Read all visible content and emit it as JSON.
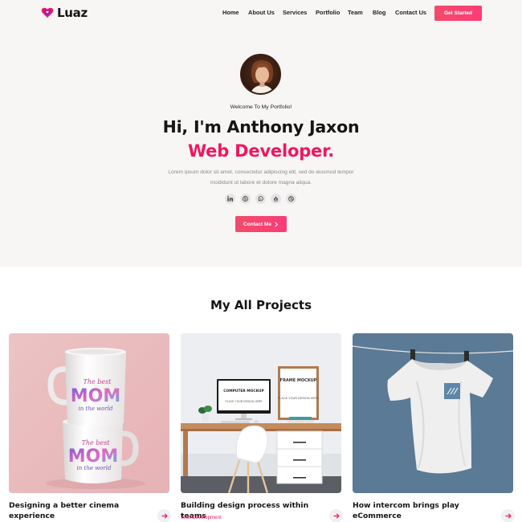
{
  "header": {
    "logo_text": "Luaz",
    "nav": [
      "Home",
      "About Us",
      "Services",
      "Portfolio",
      "Team",
      "Blog",
      "Contact Us"
    ],
    "cta_label": "Get Started"
  },
  "hero": {
    "welcome": "Welcome To My Portfolio!",
    "title": "Hi, I'm Anthony Jaxon",
    "role": "Web Developer.",
    "description": "Lorem ipsum dolor sit amet, consectetur adipiscing elit, sed do eiusmod tempor incididunt ut labore et dolore magna aliqua.",
    "socials": [
      "linkedin-icon",
      "skype-icon",
      "whatsapp-icon",
      "behance-icon",
      "dribbble-icon"
    ],
    "cta_label": "Contact Me"
  },
  "projects": {
    "title": "My All Projects",
    "cards": [
      {
        "title": "Designing a better cinema experience",
        "tag": ""
      },
      {
        "title": "Building design process within teams",
        "tag": "Web Development"
      },
      {
        "title": "How intercom brings play eCommerce",
        "tag": ""
      }
    ],
    "mug_text_top": "The best",
    "mug_text_main": "MOM",
    "mug_text_bottom": "in the world",
    "screen_title": "COMPUTER MOCKUP",
    "screen_sub": "PLACE YOUR DESIGN HERE",
    "frame_title": "FRAME MOCKUP",
    "frame_sub": "PLACE YOUR DESIGN HERE"
  },
  "colors": {
    "accent": "#f3165e",
    "hero_bg": "#f7f6f4",
    "tshirt_bg": "#5a7a96"
  }
}
